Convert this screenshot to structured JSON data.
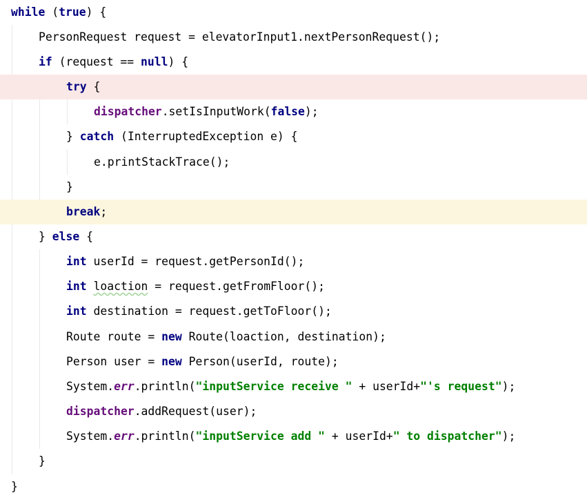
{
  "editor": {
    "lines": [
      {
        "tokens": [
          {
            "t": "while",
            "c": "kw"
          },
          {
            "t": " ("
          },
          {
            "t": "true",
            "c": "kw"
          },
          {
            "t": ") {"
          }
        ]
      },
      {
        "tokens": [
          {
            "t": "PersonRequest request = elevatorInput1.nextPersonRequest();"
          }
        ]
      },
      {
        "tokens": [
          {
            "t": "if",
            "c": "kw"
          },
          {
            "t": " (request == "
          },
          {
            "t": "null",
            "c": "kw"
          },
          {
            "t": ") {"
          }
        ]
      },
      {
        "tokens": [
          {
            "t": "try",
            "c": "kw"
          },
          {
            "t": " {"
          }
        ]
      },
      {
        "tokens": [
          {
            "t": "dispatcher",
            "c": "fld"
          },
          {
            "t": ".setIsInputWork("
          },
          {
            "t": "false",
            "c": "kw"
          },
          {
            "t": ");"
          }
        ]
      },
      {
        "tokens": [
          {
            "t": "} "
          },
          {
            "t": "catch",
            "c": "kw"
          },
          {
            "t": " (InterruptedException e) {"
          }
        ]
      },
      {
        "tokens": [
          {
            "t": "e.printStackTrace();"
          }
        ]
      },
      {
        "tokens": [
          {
            "t": "}"
          }
        ]
      },
      {
        "tokens": [
          {
            "t": "break",
            "c": "kw"
          },
          {
            "t": ";"
          }
        ]
      },
      {
        "tokens": [
          {
            "t": "} "
          },
          {
            "t": "else",
            "c": "kw"
          },
          {
            "t": " {"
          }
        ]
      },
      {
        "tokens": [
          {
            "t": "int",
            "c": "kw"
          },
          {
            "t": " userId = request.getPersonId();"
          }
        ]
      },
      {
        "tokens": [
          {
            "t": "int",
            "c": "kw"
          },
          {
            "t": " "
          },
          {
            "t": "loaction",
            "c": "typo"
          },
          {
            "t": " = request.getFromFloor();"
          }
        ]
      },
      {
        "tokens": [
          {
            "t": "int",
            "c": "kw"
          },
          {
            "t": " destination = request.getToFloor();"
          }
        ]
      },
      {
        "tokens": [
          {
            "t": "Route route = "
          },
          {
            "t": "new",
            "c": "kw"
          },
          {
            "t": " Route(loaction, destination);"
          }
        ]
      },
      {
        "tokens": [
          {
            "t": "Person user = "
          },
          {
            "t": "new",
            "c": "kw"
          },
          {
            "t": " Person(userId, route);"
          }
        ]
      },
      {
        "tokens": [
          {
            "t": "System."
          },
          {
            "t": "err",
            "c": "sfld"
          },
          {
            "t": ".println("
          },
          {
            "t": "\"inputService receive \"",
            "c": "str"
          },
          {
            "t": " + userId+"
          },
          {
            "t": "\"'s request\"",
            "c": "str"
          },
          {
            "t": ");"
          }
        ]
      },
      {
        "tokens": [
          {
            "t": "dispatcher",
            "c": "fld"
          },
          {
            "t": ".addRequest(user);"
          }
        ]
      },
      {
        "tokens": [
          {
            "t": "System."
          },
          {
            "t": "err",
            "c": "sfld"
          },
          {
            "t": ".println("
          },
          {
            "t": "\"inputService add \"",
            "c": "str"
          },
          {
            "t": " + userId+"
          },
          {
            "t": "\" to dispatcher\"",
            "c": "str"
          },
          {
            "t": ");"
          }
        ]
      },
      {
        "tokens": [
          {
            "t": "}"
          }
        ]
      },
      {
        "tokens": [
          {
            "t": "}"
          }
        ]
      }
    ]
  }
}
